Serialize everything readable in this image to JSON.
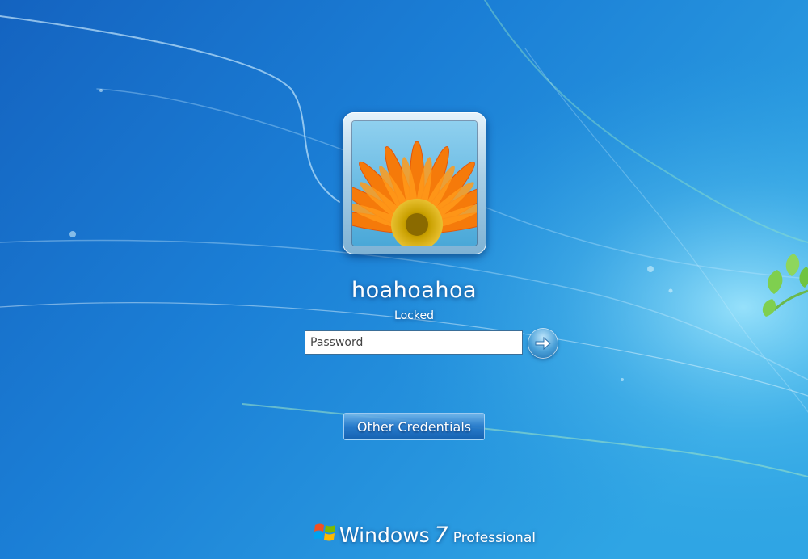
{
  "user": {
    "name": "hoahoahoa",
    "status": "Locked"
  },
  "login": {
    "password_placeholder": "Password",
    "other_credentials_label": "Other Credentials"
  },
  "branding": {
    "product": "Windows",
    "version": "7",
    "edition": "Professional"
  },
  "icons": {
    "submit": "arrow-right-icon",
    "logo": "windows-flag-icon",
    "avatar": "orange-flower-image"
  },
  "colors": {
    "background": "#1a73c9",
    "accent": "#4aa0d8"
  }
}
